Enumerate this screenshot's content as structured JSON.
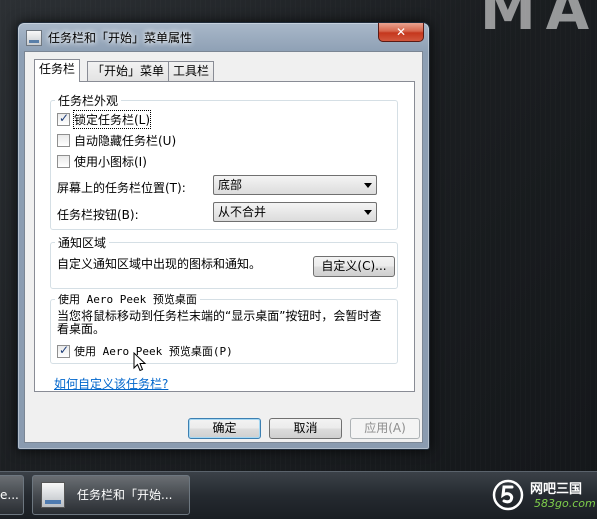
{
  "window": {
    "title": "任务栏和「开始」菜单属性",
    "close_glyph": "✕"
  },
  "tabs": [
    {
      "label": "任务栏",
      "active": true
    },
    {
      "label": "「开始」菜单",
      "active": false
    },
    {
      "label": "工具栏",
      "active": false
    }
  ],
  "appearance": {
    "title": "任务栏外观",
    "lock": {
      "label": "锁定任务栏(L)",
      "checked": true
    },
    "autohide": {
      "label": "自动隐藏任务栏(U)",
      "checked": false
    },
    "small_icons": {
      "label": "使用小图标(I)",
      "checked": false
    },
    "location_label": "屏幕上的任务栏位置(T):",
    "location_value": "底部",
    "buttons_label": "任务栏按钮(B):",
    "buttons_value": "从不合并"
  },
  "notification": {
    "title": "通知区域",
    "description": "自定义通知区域中出现的图标和通知。",
    "customize_button": "自定义(C)..."
  },
  "aero_peek": {
    "title": "使用 Aero Peek 预览桌面",
    "description": "当您将鼠标移动到任务栏末端的“显示桌面”按钮时，会暂时查看桌面。",
    "checkbox": {
      "label": "使用 Aero Peek 预览桌面(P)",
      "checked": true
    }
  },
  "help_link": "如何自定义该任务栏?",
  "footer": {
    "ok": "确定",
    "cancel": "取消",
    "apply": "应用(A)"
  },
  "wallpaper_text": "MA",
  "taskbar": {
    "left_item": "e...",
    "active_item": "任务栏和「开始..."
  },
  "watermark": {
    "name": "网吧三国",
    "url": "583go.com"
  },
  "colors": {
    "link": "#0066cc",
    "close_button": "#c5371d",
    "watermark_url": "#7fd04b"
  }
}
